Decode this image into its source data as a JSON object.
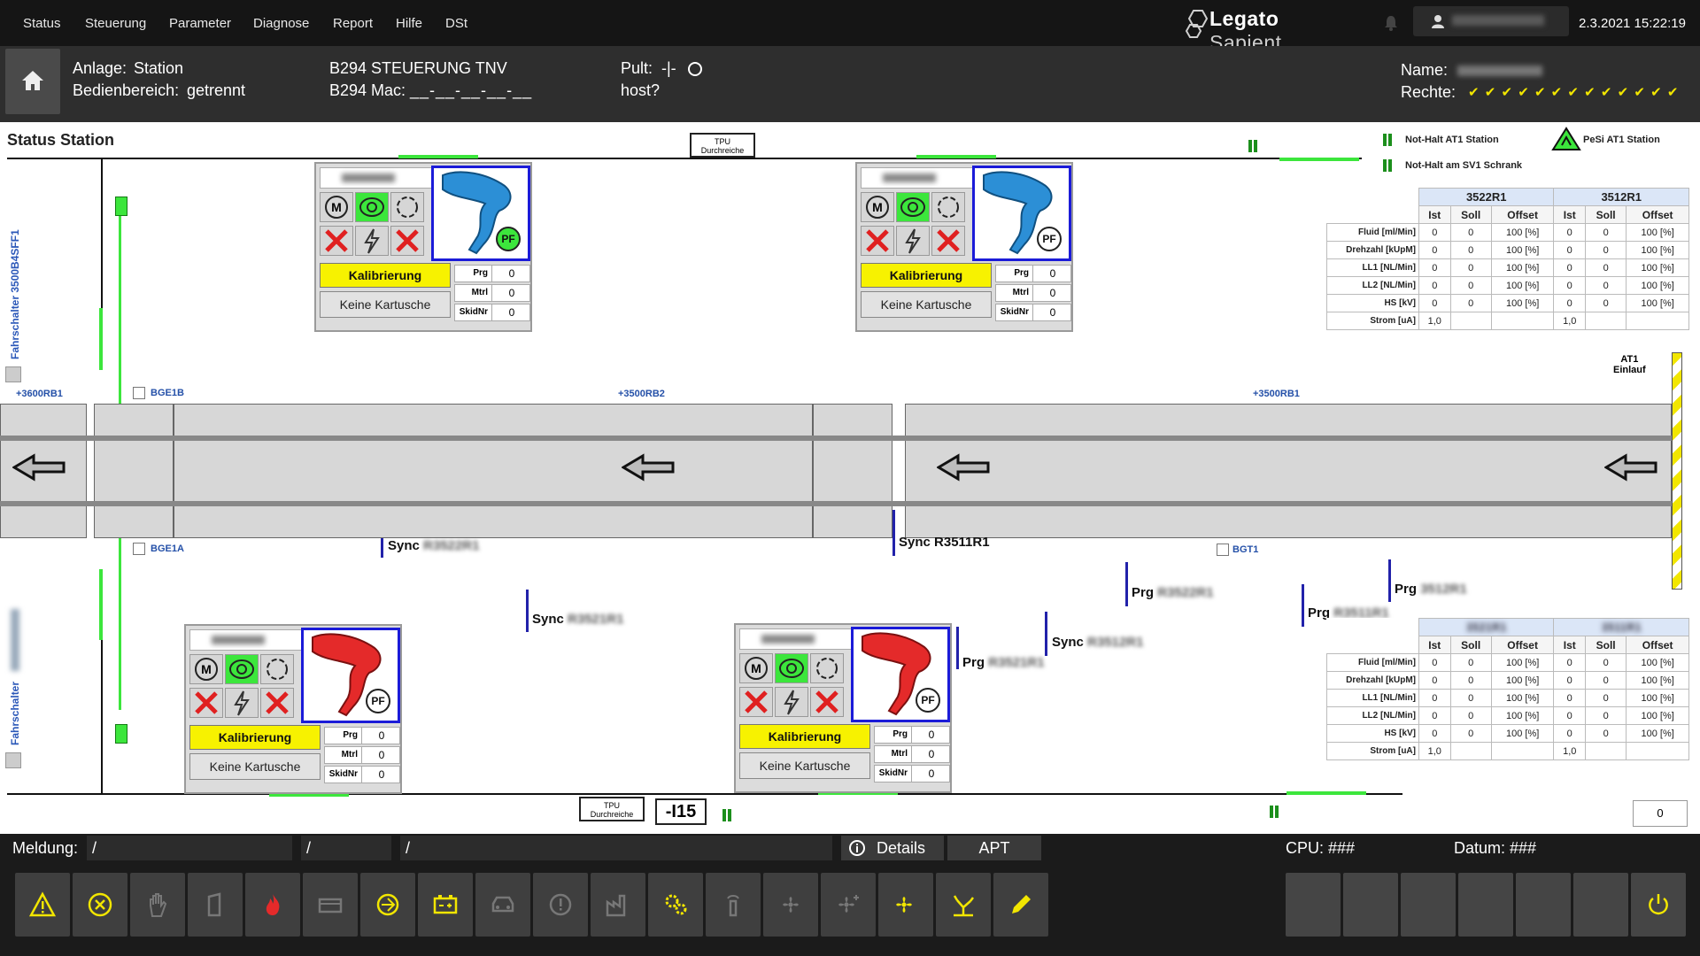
{
  "menu": {
    "items": [
      "Status",
      "Steuerung",
      "Parameter",
      "Diagnose",
      "Report",
      "Hilfe",
      "DSt"
    ]
  },
  "brand": {
    "part1": "Legato",
    "part2": "Sapient"
  },
  "datetime": "2.3.2021  15:22:19",
  "header": {
    "anlage_label": "Anlage:",
    "anlage_value": "Station",
    "bedien_label": "Bedienbereich:",
    "bedien_value": "getrennt",
    "steuerung": "B294 STEUERUNG TNV",
    "mac_label": "B294 Mac:",
    "mac_value": "__-__-__-__-__",
    "pult_label": "Pult:",
    "pult_value": "-|-",
    "host": "host?",
    "name_label": "Name:",
    "rechte_label": "Rechte:",
    "rechte_checks": "✔ ✔ ✔ ✔ ✔ ✔ ✔ ✔ ✔ ✔ ✔ ✔ ✔"
  },
  "main": {
    "title": "Status Station",
    "tpu_top": "TPU\nDurchreiche",
    "tpu_bottom": "TPU\nDurchreiche",
    "legend": {
      "nothalt_station": "Not-Halt AT1 Station",
      "pesi_station": "PeSi AT1 Station",
      "nothalt_schrank": "Not-Halt am SV1 Schrank"
    },
    "fahrschalter_top": "Fahrschalter 3500B4SFF1",
    "fahrschalter_bottom": "Fahrschalter",
    "zones": {
      "z1": "+3600RB1",
      "z2": "+3500RB2",
      "z3": "+3500RB1"
    },
    "checks": {
      "bge1b": "BGE1B",
      "bge1a": "BGE1A",
      "bgt1": "BGT1"
    },
    "at1_einlauf": "AT1\nEinlauf",
    "sync": {
      "s1": "Sync",
      "s2": "Sync R3511R1",
      "s3": "Sync",
      "s4": "Sync"
    },
    "prg": {
      "p1": "Prg",
      "p2": "Prg",
      "p3": "Prg",
      "p4": "Prg"
    },
    "robot": {
      "kalibrierung": "Kalibrierung",
      "keine_kartusche": "Keine Kartusche",
      "prg": "Prg",
      "mtrl": "Mtrl",
      "skidnr": "SkidNr",
      "val": "0",
      "pf": "PF"
    },
    "table_top": {
      "h1": "3522R1",
      "h2": "3512R1"
    },
    "table_cols": {
      "ist": "Ist",
      "soll": "Soll",
      "offset": "Offset"
    },
    "table_rows": [
      {
        "label": "Fluid [ml/Min]",
        "a": "0",
        "b": "0",
        "c": "100 [%]",
        "d": "0",
        "e": "0",
        "f": "100 [%]"
      },
      {
        "label": "Drehzahl [kUpM]",
        "a": "0",
        "b": "0",
        "c": "100 [%]",
        "d": "0",
        "e": "0",
        "f": "100 [%]"
      },
      {
        "label": "LL1 [NL/Min]",
        "a": "0",
        "b": "0",
        "c": "100 [%]",
        "d": "0",
        "e": "0",
        "f": "100 [%]"
      },
      {
        "label": "LL2 [NL/Min]",
        "a": "0",
        "b": "0",
        "c": "100 [%]",
        "d": "0",
        "e": "0",
        "f": "100 [%]"
      },
      {
        "label": "HS [kV]",
        "a": "0",
        "b": "0",
        "c": "100 [%]",
        "d": "0",
        "e": "0",
        "f": "100 [%]"
      },
      {
        "label": "Strom [uA]",
        "a": "1,0",
        "b": "",
        "c": "",
        "d": "1,0",
        "e": "",
        "f": ""
      }
    ],
    "station_id": "-I15",
    "counter": "0"
  },
  "meldung": {
    "label": "Meldung:",
    "f1": "/",
    "f2": "/",
    "f3": "/",
    "details": "Details",
    "apt": "APT",
    "cpu": "CPU: ###",
    "datum": "Datum: ###"
  },
  "colors": {
    "accent_green": "#3ce63c",
    "warn_yellow": "#f2e600",
    "robot_border": "#1b1bd8"
  }
}
